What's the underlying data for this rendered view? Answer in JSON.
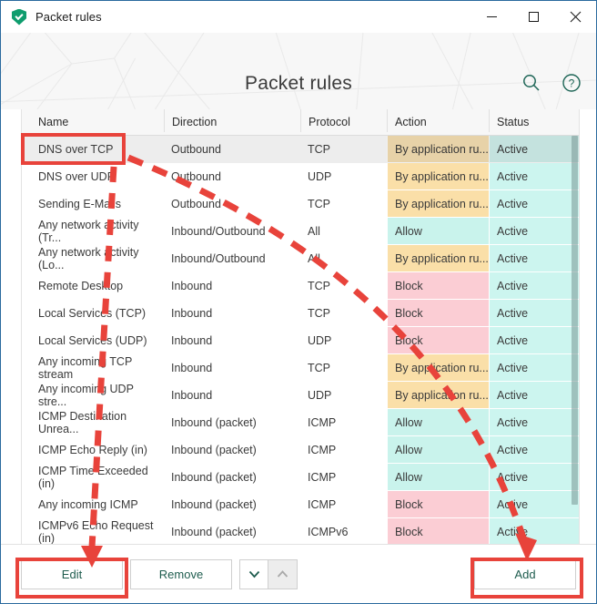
{
  "window": {
    "title": "Packet rules",
    "icon": "shield-check-icon",
    "minimize_label": "minimize-icon",
    "maximize_label": "maximize-icon",
    "close_label": "close-icon"
  },
  "header": {
    "title": "Packet rules",
    "search_icon": "search-icon",
    "help_icon": "help-icon"
  },
  "table": {
    "columns": [
      "Name",
      "Direction",
      "Protocol",
      "Action",
      "Status"
    ],
    "selected_index": 0,
    "rows": [
      {
        "name": "DNS over TCP",
        "direction": "Outbound",
        "protocol": "TCP",
        "action": "By application ru...",
        "action_kind": "app",
        "status": "Active"
      },
      {
        "name": "DNS over UDP",
        "direction": "Outbound",
        "protocol": "UDP",
        "action": "By application ru...",
        "action_kind": "app",
        "status": "Active"
      },
      {
        "name": "Sending E-Mails",
        "direction": "Outbound",
        "protocol": "TCP",
        "action": "By application ru...",
        "action_kind": "app",
        "status": "Active"
      },
      {
        "name": "Any network activity (Tr...",
        "direction": "Inbound/Outbound",
        "protocol": "All",
        "action": "Allow",
        "action_kind": "allow",
        "status": "Active"
      },
      {
        "name": "Any network activity (Lo...",
        "direction": "Inbound/Outbound",
        "protocol": "All",
        "action": "By application ru...",
        "action_kind": "app",
        "status": "Active"
      },
      {
        "name": "Remote Desktop",
        "direction": "Inbound",
        "protocol": "TCP",
        "action": "Block",
        "action_kind": "block",
        "status": "Active"
      },
      {
        "name": "Local Services (TCP)",
        "direction": "Inbound",
        "protocol": "TCP",
        "action": "Block",
        "action_kind": "block",
        "status": "Active"
      },
      {
        "name": "Local Services (UDP)",
        "direction": "Inbound",
        "protocol": "UDP",
        "action": "Block",
        "action_kind": "block",
        "status": "Active"
      },
      {
        "name": "Any incoming TCP stream",
        "direction": "Inbound",
        "protocol": "TCP",
        "action": "By application ru...",
        "action_kind": "app",
        "status": "Active"
      },
      {
        "name": "Any incoming UDP stre...",
        "direction": "Inbound",
        "protocol": "UDP",
        "action": "By application ru...",
        "action_kind": "app",
        "status": "Active"
      },
      {
        "name": "ICMP Destination Unrea...",
        "direction": "Inbound (packet)",
        "protocol": "ICMP",
        "action": "Allow",
        "action_kind": "allow",
        "status": "Active"
      },
      {
        "name": "ICMP Echo Reply (in)",
        "direction": "Inbound (packet)",
        "protocol": "ICMP",
        "action": "Allow",
        "action_kind": "allow",
        "status": "Active"
      },
      {
        "name": "ICMP Time Exceeded (in)",
        "direction": "Inbound (packet)",
        "protocol": "ICMP",
        "action": "Allow",
        "action_kind": "allow",
        "status": "Active"
      },
      {
        "name": "Any incoming ICMP",
        "direction": "Inbound (packet)",
        "protocol": "ICMP",
        "action": "Block",
        "action_kind": "block",
        "status": "Active"
      },
      {
        "name": "ICMPv6 Echo Request (in)",
        "direction": "Inbound (packet)",
        "protocol": "ICMPv6",
        "action": "Block",
        "action_kind": "block",
        "status": "Active"
      },
      {
        "name": "",
        "direction": "",
        "protocol": "",
        "action": "",
        "action_kind": "none",
        "status": ""
      }
    ]
  },
  "footer": {
    "edit_label": "Edit",
    "remove_label": "Remove",
    "add_label": "Add",
    "move_down_icon": "chevron-down-icon",
    "move_up_icon": "chevron-up-icon"
  },
  "annotations": {
    "highlight_row": "DNS over TCP",
    "highlight_edit": "Edit",
    "highlight_add": "Add",
    "color": "#e8433b"
  },
  "colors": {
    "accent": "#1e5c4e",
    "action_app": "#fadfa8",
    "action_allow": "#c9f3ec",
    "action_block": "#fbcdd4",
    "status_active": "#ccf5ef",
    "window_border": "#2a6a9e"
  }
}
